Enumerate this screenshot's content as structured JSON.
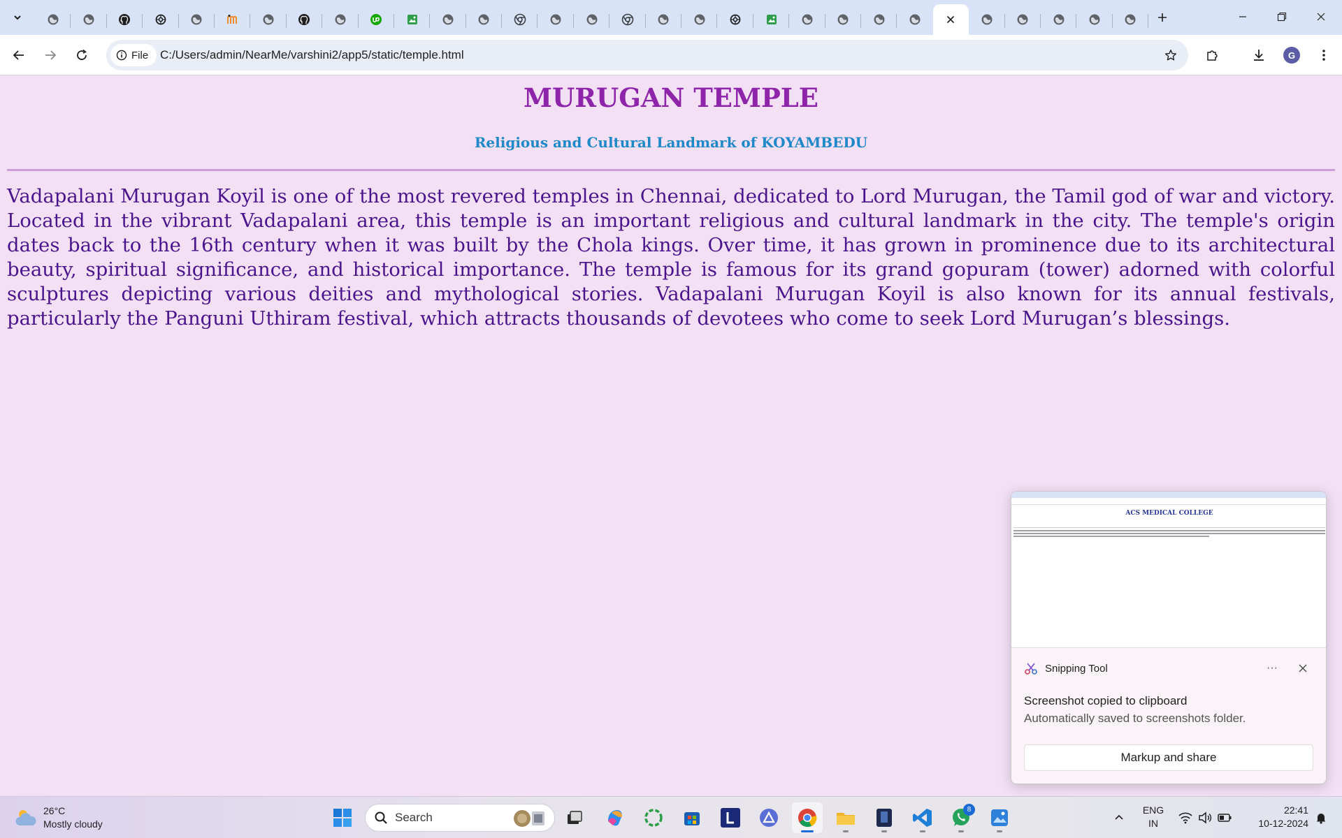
{
  "browser": {
    "tabs": [
      {
        "icon": "globe-icon"
      },
      {
        "icon": "globe-icon"
      },
      {
        "icon": "github-icon"
      },
      {
        "icon": "openai-icon"
      },
      {
        "icon": "globe-icon"
      },
      {
        "icon": "m-logo-icon"
      },
      {
        "icon": "globe-icon"
      },
      {
        "icon": "github-icon"
      },
      {
        "icon": "globe-icon"
      },
      {
        "icon": "upwork-icon"
      },
      {
        "icon": "image-icon"
      },
      {
        "icon": "globe-icon"
      },
      {
        "icon": "globe-icon"
      },
      {
        "icon": "chrome-icon"
      },
      {
        "icon": "globe-icon"
      },
      {
        "icon": "globe-icon"
      },
      {
        "icon": "chrome-icon"
      },
      {
        "icon": "globe-icon"
      },
      {
        "icon": "globe-icon"
      },
      {
        "icon": "openai-icon"
      },
      {
        "icon": "image-icon"
      },
      {
        "icon": "globe-icon"
      },
      {
        "icon": "globe-icon"
      },
      {
        "icon": "globe-icon"
      },
      {
        "icon": "globe-icon"
      },
      {
        "icon": "close-icon",
        "active": true
      },
      {
        "icon": "globe-icon"
      },
      {
        "icon": "globe-icon"
      },
      {
        "icon": "globe-icon"
      },
      {
        "icon": "globe-icon"
      },
      {
        "icon": "globe-icon"
      }
    ],
    "site_chip_label": "File",
    "url": "C:/Users/admin/NearMe/varshini2/app5/static/temple.html",
    "profile_initial": "G"
  },
  "page": {
    "title": "MURUGAN TEMPLE",
    "subtitle": "Religious and Cultural Landmark of KOYAMBEDU",
    "body": "Vadapalani Murugan Koyil is one of the most revered temples in Chennai, dedicated to Lord Murugan, the Tamil god of war and victory. Located in the vibrant Vadapalani area, this temple is an important religious and cultural landmark in the city. The temple's origin dates back to the 16th century when it was built by the Chola kings. Over time, it has grown in prominence due to its architectural beauty, spiritual significance, and historical importance. The temple is famous for its grand gopuram (tower) adorned with colorful sculptures depicting various deities and mythological stories. Vadapalani Murugan Koyil is also known for its annual festivals, particularly the Panguni Uthiram festival, which attracts thousands of devotees who come to seek Lord Murugan’s blessings."
  },
  "toast": {
    "preview_title": "ACS MEDICAL COLLEGE",
    "app_name": "Snipping Tool",
    "more_label": "···",
    "message": "Screenshot copied to clipboard",
    "sub_message": "Automatically saved to screenshots folder.",
    "button_label": "Markup and share"
  },
  "taskbar": {
    "temperature": "26°C",
    "condition": "Mostly cloudy",
    "search_label": "Search",
    "whatsapp_badge": "8",
    "lang_line1": "ENG",
    "lang_line2": "IN",
    "time": "22:41",
    "date": "10-12-2024"
  },
  "colors": {
    "page_background": "#f3e0f5",
    "title": "#8e24aa",
    "subtitle": "#1e88c8",
    "body_text": "#4a148c",
    "tabstrip": "#d9e3f7",
    "accent": "#1a6bd6"
  }
}
